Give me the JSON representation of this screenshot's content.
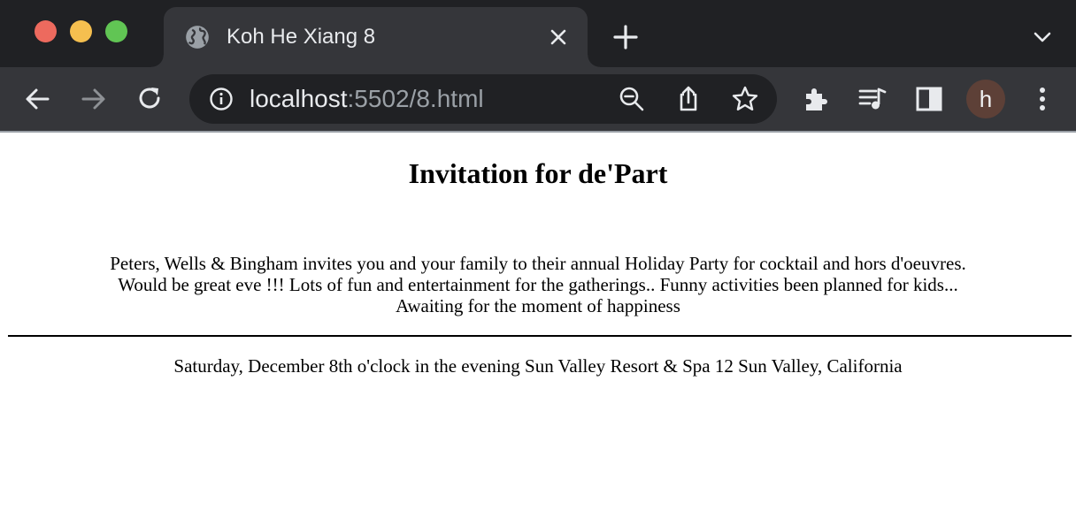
{
  "browser": {
    "tab": {
      "title": "Koh He Xiang 8",
      "favicon": "globe-icon"
    },
    "address": {
      "host": "localhost",
      "path": ":5502/8.html"
    },
    "profile_initial": "h",
    "colors": {
      "frame": "#202124",
      "toolbar": "#35363a",
      "avatar": "#5d4037"
    }
  },
  "page": {
    "title": "Invitation for de'Part",
    "intro_lines": [
      "Peters, Wells & Bingham invites you and your family to their annual Holiday Party for cocktail and hors d'oeuvres.",
      "Would be great eve !!! Lots of fun and entertainment for the gatherings.. Funny activities been planned for kids...",
      "Awaiting for the moment of happiness"
    ],
    "details": "Saturday, December 8th o'clock in the evening Sun Valley Resort & Spa 12 Sun Valley, California"
  }
}
